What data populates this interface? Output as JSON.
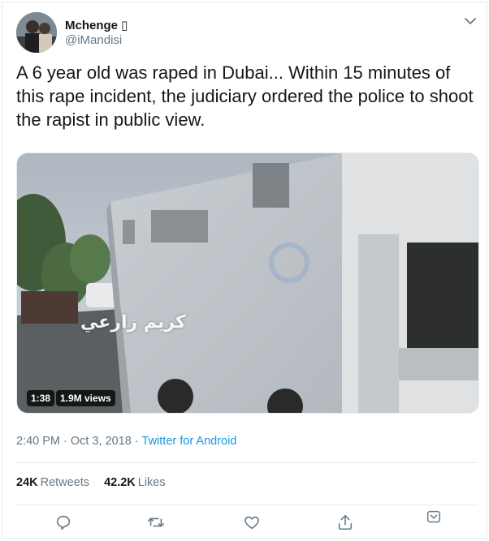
{
  "author": {
    "name": "Mchenge ▯",
    "handle": "@iMandisi"
  },
  "tweet": {
    "text": "A 6 year old was raped in Dubai... Within 15 minutes of this rape incident, the judiciary ordered the police to shoot the rapist in public view."
  },
  "media": {
    "duration": "1:38",
    "views": "1.9M views",
    "overlay_text": "كريم زارعي"
  },
  "meta": {
    "time": "2:40 PM",
    "date": "Oct 3, 2018",
    "separator": "·",
    "source": "Twitter for Android"
  },
  "stats": {
    "retweets_count": "24K",
    "retweets_label": "Retweets",
    "likes_count": "42.2K",
    "likes_label": "Likes"
  },
  "icons": {
    "menu": "chevron-down-icon",
    "reply": "reply-icon",
    "retweet": "retweet-icon",
    "like": "heart-icon",
    "share": "share-icon",
    "analytics": "bookmark-icon"
  },
  "colors": {
    "link": "#1b95e0",
    "muted": "#657786",
    "text": "#14171a",
    "border": "#e6ecf0"
  }
}
